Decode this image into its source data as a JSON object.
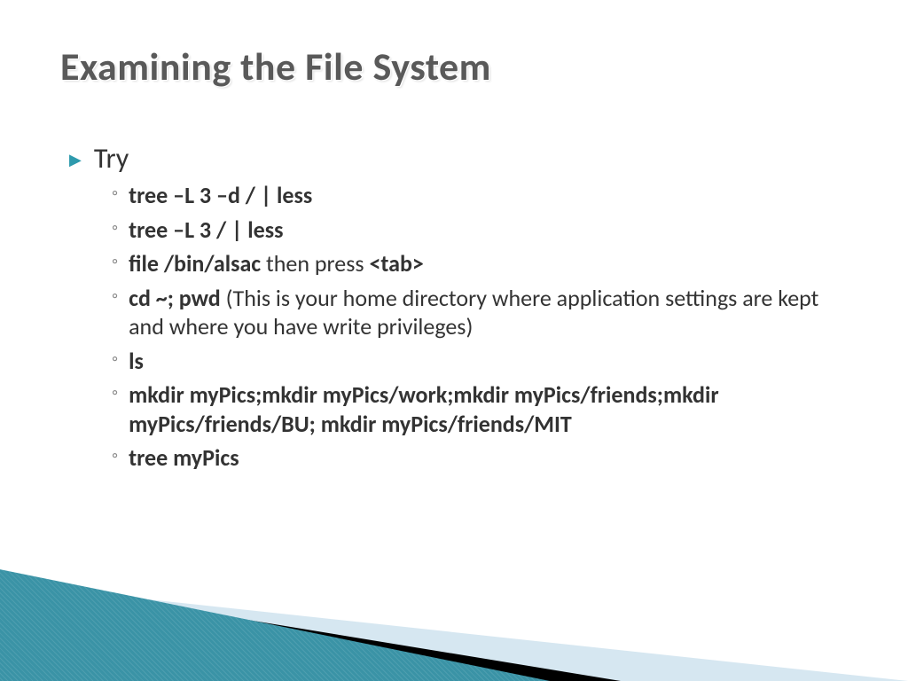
{
  "title": "Examining the File System",
  "top": {
    "label": "Try"
  },
  "items": [
    {
      "b1": "tree –L 3 –d  / | less"
    },
    {
      "b1": "tree –L 3   / | less"
    },
    {
      "b1": "file /bin/alsac ",
      "t1": "then press ",
      "b2": "<tab>"
    },
    {
      "b1": "cd ~; pwd ",
      "t1": "(This is your home directory where application settings are kept and where you have write privileges)"
    },
    {
      "b1": "ls"
    },
    {
      "b1": "mkdir myPics;mkdir myPics/work;mkdir myPics/friends;mkdir myPics/friends/BU; mkdir myPics/friends/MIT"
    },
    {
      "b1": "tree myPics"
    }
  ]
}
